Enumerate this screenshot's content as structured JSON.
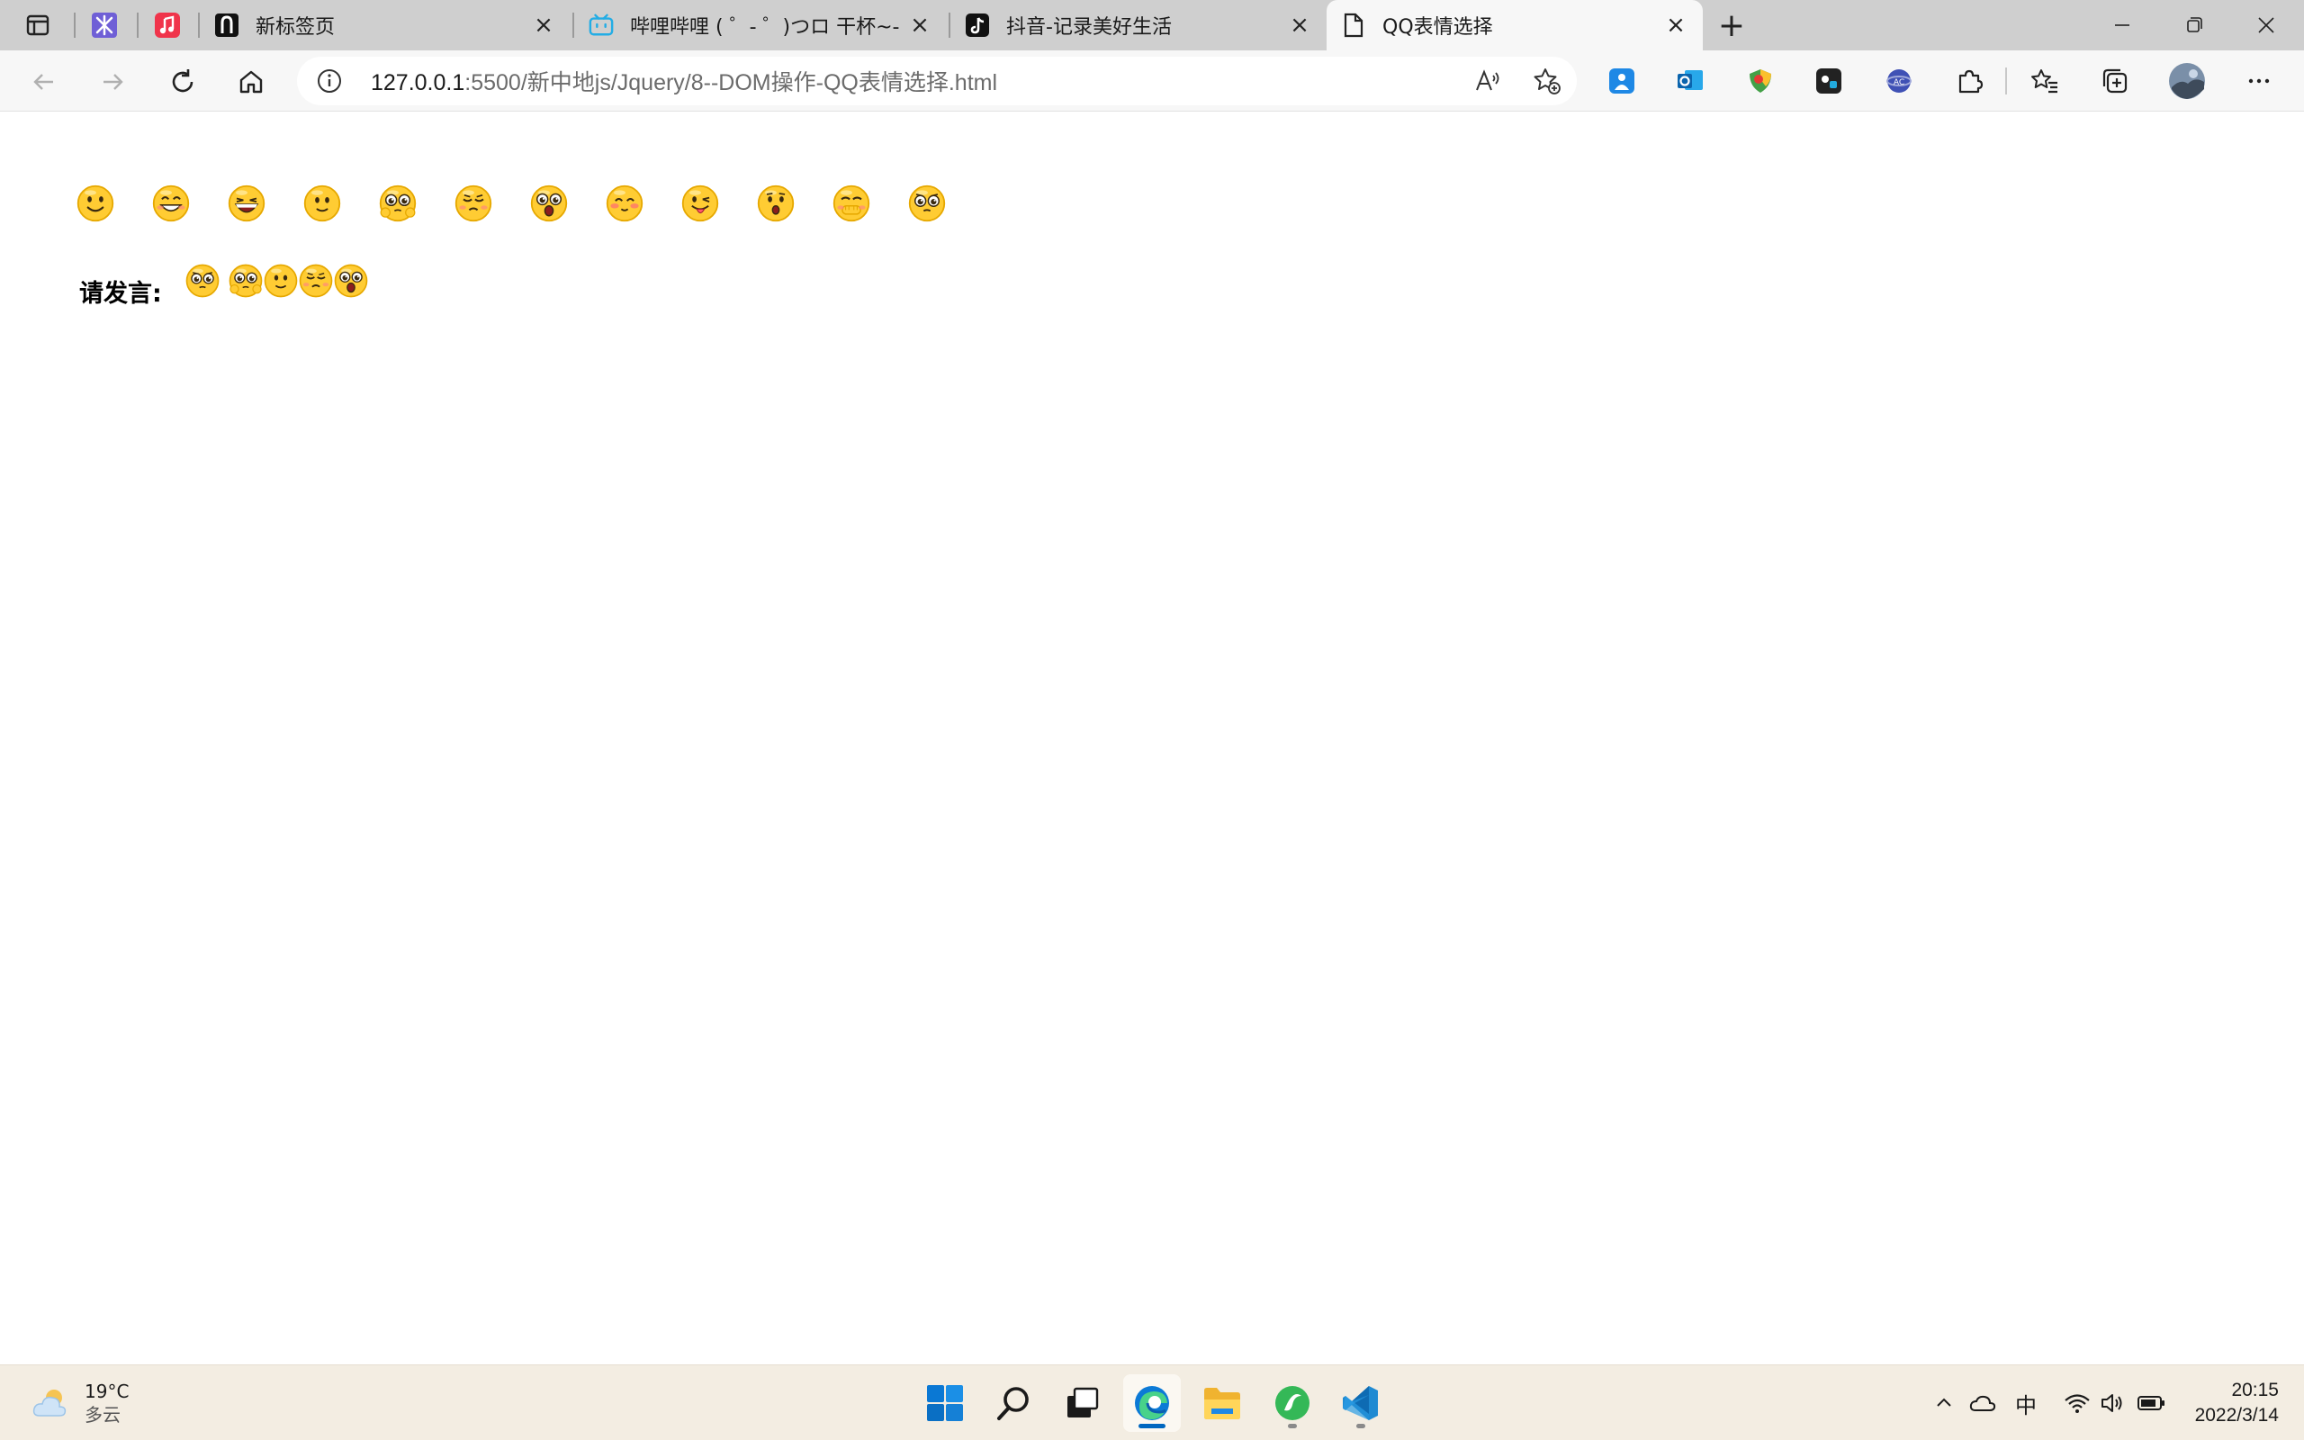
{
  "browser": {
    "tabs": [
      {
        "title": "",
        "kind": "pinned",
        "icon": "pinned-app-icon-purple"
      },
      {
        "title": "",
        "kind": "pinned",
        "icon": "music-app-icon"
      },
      {
        "title": "新标签页",
        "kind": "normal",
        "icon": "new-tab-favicon"
      },
      {
        "title": "哔哩哔哩 ( ゜- ゜)つロ 干杯~-bilibili",
        "kind": "normal",
        "icon": "bilibili-favicon"
      },
      {
        "title": "抖音-记录美好生活",
        "kind": "normal",
        "icon": "douyin-favicon"
      },
      {
        "title": "QQ表情选择",
        "kind": "active",
        "icon": "document-favicon"
      }
    ],
    "new_tab_label": "+",
    "address_host": "127.0.0.1",
    "address_path": ":5500/新中地js/Jquery/8--DOM操作-QQ表情选择.html"
  },
  "page": {
    "speak_label": "请发言:",
    "emojis": [
      {
        "name": "smile"
      },
      {
        "name": "grin"
      },
      {
        "name": "laugh"
      },
      {
        "name": "slight-smile"
      },
      {
        "name": "shy-hands"
      },
      {
        "name": "sigh"
      },
      {
        "name": "shocked"
      },
      {
        "name": "blush"
      },
      {
        "name": "tongue-wink"
      },
      {
        "name": "surprised"
      },
      {
        "name": "cover-mouth"
      },
      {
        "name": "pleading"
      }
    ],
    "chosen": [
      {
        "name": "pleading"
      },
      {
        "name": "shy-hands"
      },
      {
        "name": "slight-smile"
      },
      {
        "name": "sigh"
      },
      {
        "name": "shocked"
      }
    ]
  },
  "taskbar": {
    "weather_temp": "19°C",
    "weather_desc": "多云",
    "ime": "中",
    "time": "20:15",
    "date": "2022/3/14"
  },
  "colors": {
    "emoji_face": "#ffcc33",
    "emoji_edge": "#e6a800",
    "accent": "#0067c0"
  }
}
